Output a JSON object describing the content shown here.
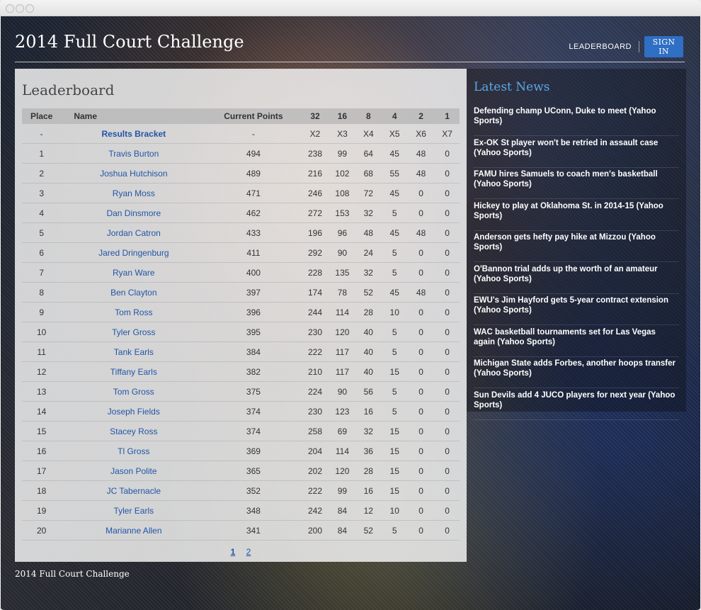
{
  "site_title": "2014 Full Court Challenge",
  "nav": {
    "leaderboard": "LEADERBOARD",
    "sign_in": "SIGN IN"
  },
  "leaderboard": {
    "title": "Leaderboard",
    "headers": [
      "Place",
      "Name",
      "Current Points",
      "32",
      "16",
      "8",
      "4",
      "2",
      "1"
    ],
    "bracket_row": [
      "-",
      "Results Bracket",
      "-",
      "X2",
      "X3",
      "X4",
      "X5",
      "X6",
      "X7"
    ],
    "rows": [
      [
        "1",
        "Travis Burton",
        "494",
        "238",
        "99",
        "64",
        "45",
        "48",
        "0"
      ],
      [
        "2",
        "Joshua Hutchison",
        "489",
        "216",
        "102",
        "68",
        "55",
        "48",
        "0"
      ],
      [
        "3",
        "Ryan Moss",
        "471",
        "246",
        "108",
        "72",
        "45",
        "0",
        "0"
      ],
      [
        "4",
        "Dan Dinsmore",
        "462",
        "272",
        "153",
        "32",
        "5",
        "0",
        "0"
      ],
      [
        "5",
        "Jordan Catron",
        "433",
        "196",
        "96",
        "48",
        "45",
        "48",
        "0"
      ],
      [
        "6",
        "Jared Dringenburg",
        "411",
        "292",
        "90",
        "24",
        "5",
        "0",
        "0"
      ],
      [
        "7",
        "Ryan Ware",
        "400",
        "228",
        "135",
        "32",
        "5",
        "0",
        "0"
      ],
      [
        "8",
        "Ben Clayton",
        "397",
        "174",
        "78",
        "52",
        "45",
        "48",
        "0"
      ],
      [
        "9",
        "Tom Ross",
        "396",
        "244",
        "114",
        "28",
        "10",
        "0",
        "0"
      ],
      [
        "10",
        "Tyler Gross",
        "395",
        "230",
        "120",
        "40",
        "5",
        "0",
        "0"
      ],
      [
        "11",
        "Tank Earls",
        "384",
        "222",
        "117",
        "40",
        "5",
        "0",
        "0"
      ],
      [
        "12",
        "Tiffany Earls",
        "382",
        "210",
        "117",
        "40",
        "15",
        "0",
        "0"
      ],
      [
        "13",
        "Tom Gross",
        "375",
        "224",
        "90",
        "56",
        "5",
        "0",
        "0"
      ],
      [
        "14",
        "Joseph Fields",
        "374",
        "230",
        "123",
        "16",
        "5",
        "0",
        "0"
      ],
      [
        "15",
        "Stacey Ross",
        "374",
        "258",
        "69",
        "32",
        "15",
        "0",
        "0"
      ],
      [
        "16",
        "Tl Gross",
        "369",
        "204",
        "114",
        "36",
        "15",
        "0",
        "0"
      ],
      [
        "17",
        "Jason Polite",
        "365",
        "202",
        "120",
        "28",
        "15",
        "0",
        "0"
      ],
      [
        "18",
        "JC Tabernacle",
        "352",
        "222",
        "99",
        "16",
        "15",
        "0",
        "0"
      ],
      [
        "19",
        "Tyler Earls",
        "348",
        "242",
        "84",
        "12",
        "10",
        "0",
        "0"
      ],
      [
        "20",
        "Marianne Allen",
        "341",
        "200",
        "84",
        "52",
        "5",
        "0",
        "0"
      ]
    ],
    "pages": [
      "1",
      "2"
    ],
    "current_page": "1"
  },
  "news": {
    "title": "Latest News",
    "items": [
      "Defending champ UConn, Duke to meet (Yahoo Sports)",
      "Ex-OK St player won't be retried in assault case (Yahoo Sports)",
      "FAMU hires Samuels to coach men's basketball (Yahoo Sports)",
      "Hickey to play at Oklahoma St. in 2014-15 (Yahoo Sports)",
      "Anderson gets hefty pay hike at Mizzou (Yahoo Sports)",
      "O'Bannon trial adds up the worth of an amateur (Yahoo Sports)",
      "EWU's Jim Hayford gets 5-year contract extension (Yahoo Sports)",
      "WAC basketball tournaments set for Las Vegas again (Yahoo Sports)",
      "Michigan State adds Forbes, another hoops transfer (Yahoo Sports)",
      "Sun Devils add 4 JUCO players for next year (Yahoo Sports)"
    ]
  },
  "footer": "2014 Full Court Challenge"
}
